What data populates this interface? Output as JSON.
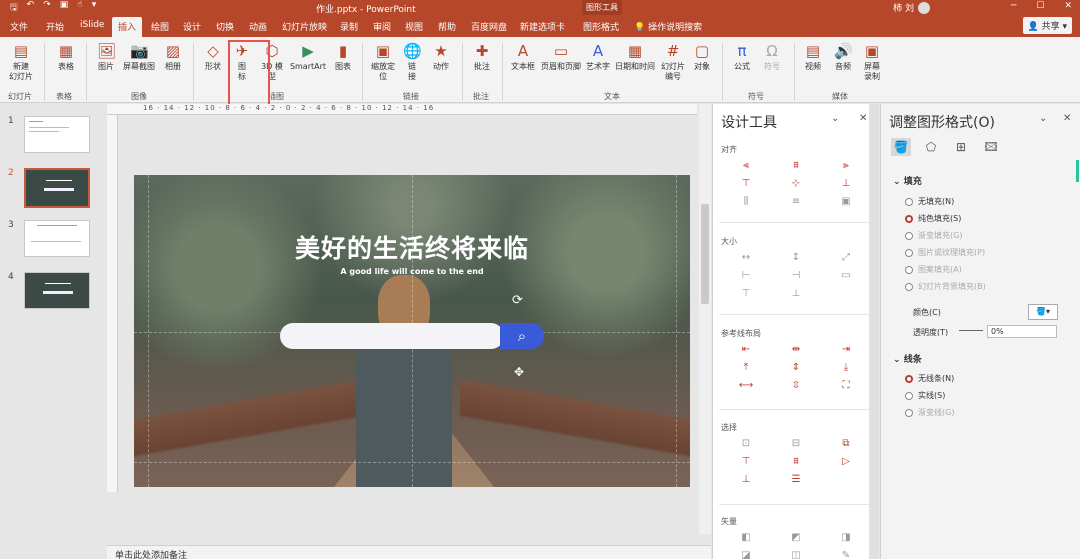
{
  "titlebar": {
    "doc_title": "作业.pptx  -  PowerPoint",
    "context_tool": "图形工具",
    "user_name": "柿 刘"
  },
  "tabs": [
    "文件",
    "开始",
    "iSlide",
    "插入",
    "绘图",
    "设计",
    "切换",
    "动画",
    "幻灯片放映",
    "录制",
    "审阅",
    "视图",
    "帮助",
    "百度网盘",
    "新建选项卡",
    "图形格式"
  ],
  "tell_me": "操作说明搜索",
  "share": "共享",
  "ribbon": {
    "new_slide": "新建\n幻灯片",
    "table": "表格",
    "image": "图片",
    "screenshot": "屏幕截图",
    "album": "相册",
    "shapes": "形状",
    "icons": "图\n标",
    "model3d": "3D 模\n型",
    "smartart": "SmartArt",
    "chart": "图表",
    "zoom": "缩放定\n位",
    "link": "链\n接",
    "action": "动作",
    "comment": "批注",
    "textbox": "文本框",
    "header_footer": "页眉和页脚",
    "wordart": "艺术字",
    "datetime": "日期和时间",
    "slide_number": "幻灯片\n编号",
    "object": "对象",
    "equation": "公式",
    "symbol": "符号",
    "video": "视频",
    "audio": "音频",
    "screen_record": "屏幕\n录制",
    "groups": {
      "slides": "幻灯片",
      "tables": "表格",
      "images": "图像",
      "illustrations": "插图",
      "links": "链接",
      "comments": "批注",
      "text": "文本",
      "symbols": "符号",
      "media": "媒体"
    }
  },
  "thumbnails": {
    "n1": "1",
    "n2": "2",
    "n3": "3",
    "n4": "4"
  },
  "ruler_text": "16 · 14 · 12 · 10 · 8 · 6 · 4 · 2 · 0 · 2 · 4 · 6 · 8 · 10 · 12 · 14 · 16",
  "slide": {
    "title": "美好的生活终将来临",
    "subtitle": "A good life will come to the end"
  },
  "notes": "单击此处添加备注",
  "design_tools": {
    "title": "设计工具",
    "align": "对齐",
    "size": "大小",
    "guides": "参考线布局",
    "select": "选择",
    "vector": "矢量"
  },
  "format_pane": {
    "title": "调整图形格式(O)",
    "fill": "填充",
    "no_fill": "无填充(N)",
    "solid_fill": "纯色填充(S)",
    "gradient_fill": "渐变填充(G)",
    "picture_fill": "图片或纹理填充(P)",
    "pattern_fill": "图案填充(A)",
    "slide_bg_fill": "幻灯片背景填充(B)",
    "color": "颜色(C)",
    "transparency": "透明度(T)",
    "transparency_value": "0%",
    "line": "线条",
    "no_line": "无线条(N)",
    "solid_line": "实线(S)",
    "gradient_line": "渐变线(G)"
  }
}
